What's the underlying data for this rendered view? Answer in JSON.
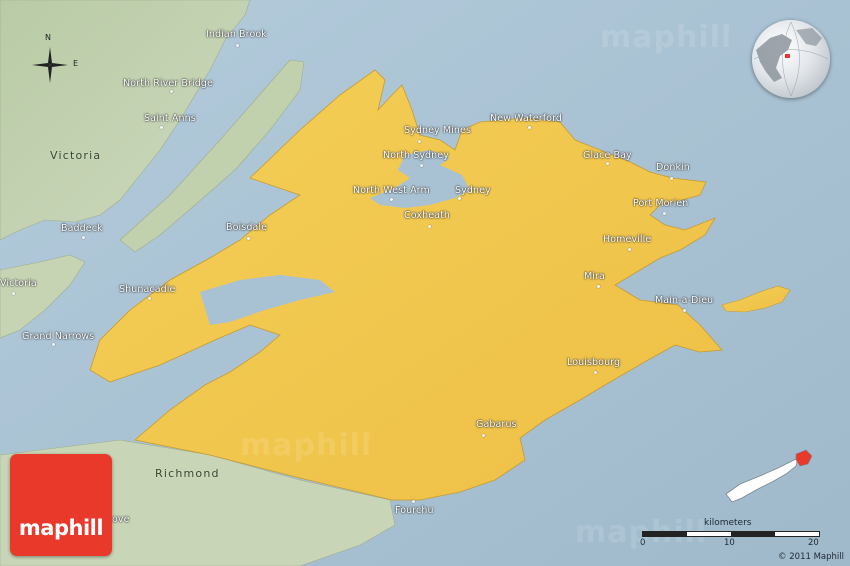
{
  "map": {
    "region_labels": [
      "Victoria",
      "Richmond"
    ],
    "places": [
      {
        "name": "Indian Brook"
      },
      {
        "name": "North River Bridge"
      },
      {
        "name": "Saint Anns"
      },
      {
        "name": "Baddeck"
      },
      {
        "name": "Boisdale"
      },
      {
        "name": "Victoria"
      },
      {
        "name": "Shunacadie"
      },
      {
        "name": "Grand Narrows"
      },
      {
        "name": "Sydney Mines"
      },
      {
        "name": "New Waterford"
      },
      {
        "name": "North Sydney"
      },
      {
        "name": "Glace Bay"
      },
      {
        "name": "Donkin"
      },
      {
        "name": "North West Arm"
      },
      {
        "name": "Sydney"
      },
      {
        "name": "Coxheath"
      },
      {
        "name": "Port Morien"
      },
      {
        "name": "Homeville"
      },
      {
        "name": "Mira"
      },
      {
        "name": "Main-a-Dieu"
      },
      {
        "name": "Louisbourg"
      },
      {
        "name": "Gabarus"
      },
      {
        "name": "Fourchu"
      },
      {
        "name": "ove"
      }
    ],
    "compass": {
      "n": "N",
      "e": "E"
    },
    "watermark": "maphill",
    "colors": {
      "sea": "#a9c2d3",
      "highlight": "#f2c74e",
      "land": "#c4d3b1",
      "logo": "#e8392b"
    }
  },
  "logo": {
    "text": "maphill"
  },
  "scale": {
    "title": "kilometers",
    "ticks": [
      "0",
      "10",
      "20"
    ]
  },
  "copyright": "© 2011 Maphill"
}
